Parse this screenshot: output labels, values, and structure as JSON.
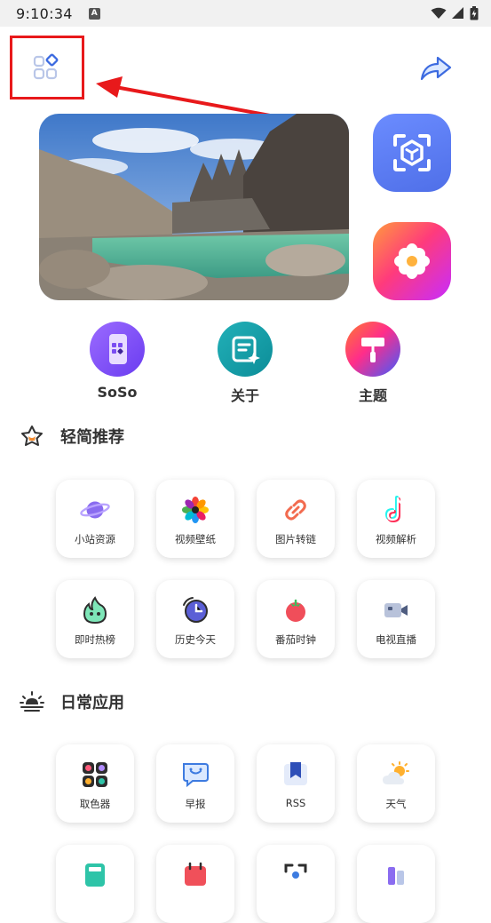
{
  "status": {
    "time": "9:10:34",
    "a_badge": "A"
  },
  "quick_actions": [
    {
      "label": "SoSo",
      "icon": "phone-grid-icon"
    },
    {
      "label": "关于",
      "icon": "note-sparkle-icon"
    },
    {
      "label": "主题",
      "icon": "paint-roller-icon"
    }
  ],
  "sections": [
    {
      "title": "轻简推荐",
      "tiles": [
        {
          "label": "小站资源",
          "icon": "planet-icon"
        },
        {
          "label": "视频壁纸",
          "icon": "flower-icon"
        },
        {
          "label": "图片转链",
          "icon": "link-icon"
        },
        {
          "label": "视频解析",
          "icon": "tiktok-icon"
        },
        {
          "label": "即时热榜",
          "icon": "flame-icon"
        },
        {
          "label": "历史今天",
          "icon": "clock-icon"
        },
        {
          "label": "番茄时钟",
          "icon": "tomato-icon"
        },
        {
          "label": "电视直播",
          "icon": "video-camera-icon"
        }
      ]
    },
    {
      "title": "日常应用",
      "tiles": [
        {
          "label": "取色器",
          "icon": "palette-icon"
        },
        {
          "label": "早报",
          "icon": "chat-bubble-icon"
        },
        {
          "label": "RSS",
          "icon": "bookmark-icon"
        },
        {
          "label": "天气",
          "icon": "weather-icon"
        }
      ]
    }
  ],
  "colors": {
    "accent_red": "#e8191b",
    "brand_blue": "#4f6fe8"
  }
}
